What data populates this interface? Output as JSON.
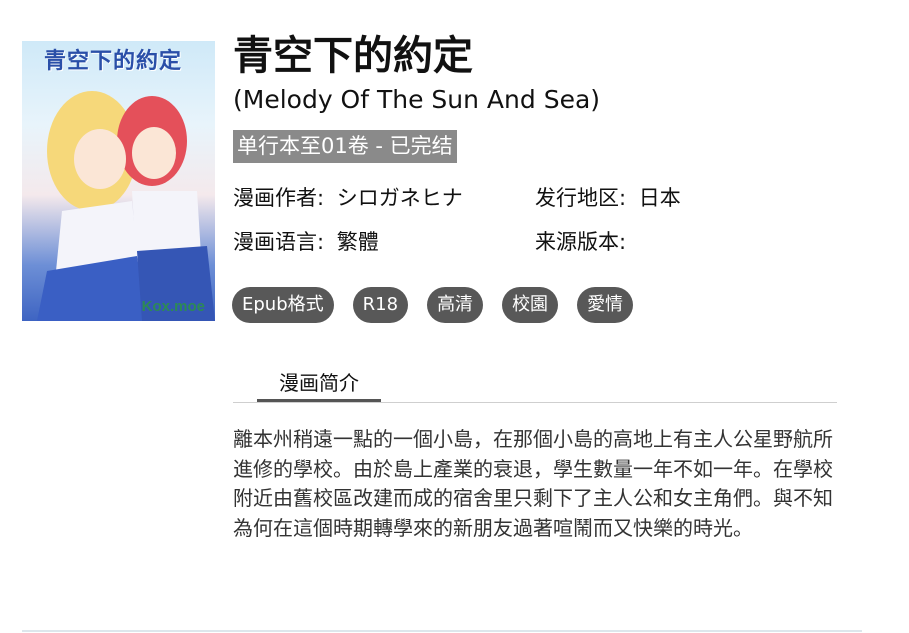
{
  "cover": {
    "title_art": "青空下的約定",
    "brand": "Kox.moe"
  },
  "title": "青空下的約定",
  "subtitle": "(Melody Of The Sun And Sea)",
  "status": "单行本至01卷 - 已完结",
  "meta": {
    "author_label": "漫画作者:",
    "author": "シロガネヒナ",
    "region_label": "发行地区:",
    "region": "日本",
    "language_label": "漫画语言:",
    "language": "繁體",
    "source_label": "来源版本:",
    "source": ""
  },
  "tags": [
    "Epub格式",
    "R18",
    "高清",
    "校園",
    "愛情"
  ],
  "tab_label": "漫画简介",
  "description": "離本州稍遠一點的一個小島，在那個小島的高地上有主人公星野航所進修的學校。由於島上產業的衰退，學生數量一年不如一年。在學校附近由舊校區改建而成的宿舍里只剩下了主人公和女主角們。與不知為何在這個時期轉學來的新朋友過著喧鬧而又快樂的時光。"
}
